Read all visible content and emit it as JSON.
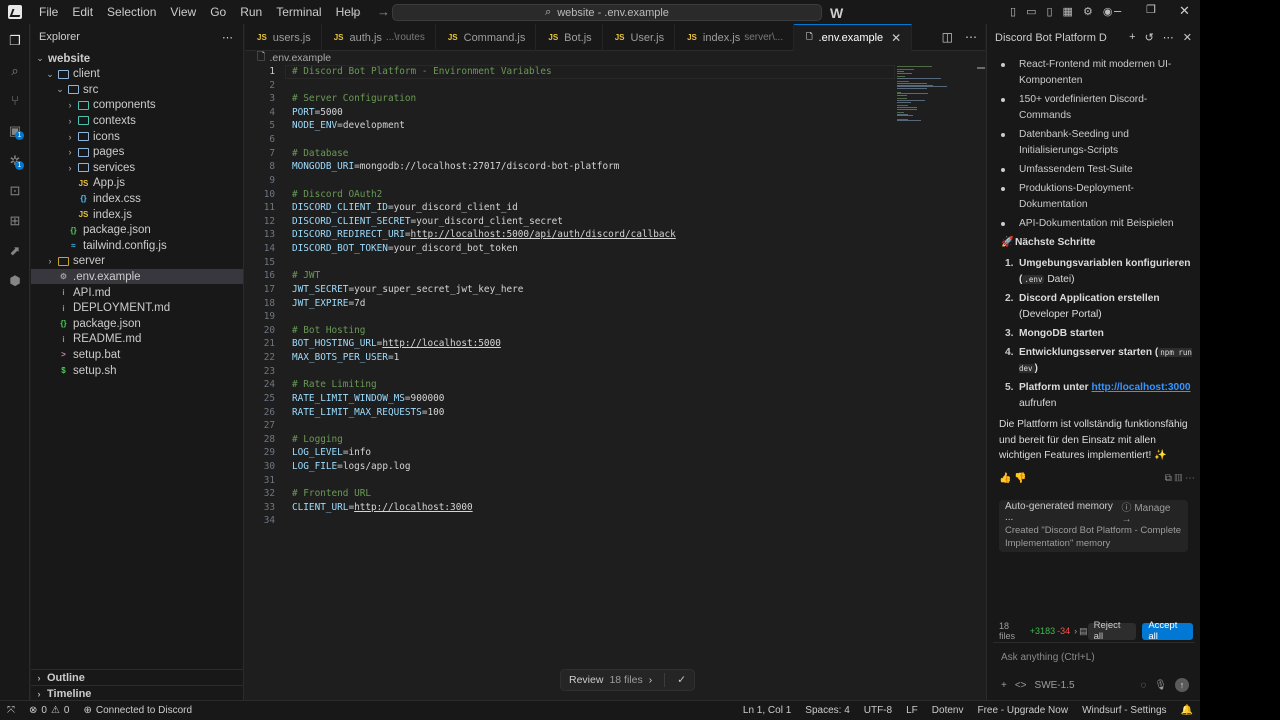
{
  "menu": [
    "File",
    "Edit",
    "Selection",
    "View",
    "Go",
    "Run",
    "Terminal",
    "Help"
  ],
  "search": {
    "text": "website - .env.example"
  },
  "sidebar": {
    "title": "Explorer",
    "tree": [
      {
        "label": "website",
        "type": "root",
        "depth": 0,
        "expanded": true
      },
      {
        "label": "client",
        "type": "folder",
        "depth": 1,
        "expanded": true
      },
      {
        "label": "src",
        "type": "folder",
        "depth": 2,
        "expanded": true
      },
      {
        "label": "components",
        "type": "folder",
        "depth": 3,
        "expanded": false
      },
      {
        "label": "contexts",
        "type": "folder",
        "depth": 3,
        "expanded": false
      },
      {
        "label": "icons",
        "type": "folder",
        "depth": 3,
        "expanded": false
      },
      {
        "label": "pages",
        "type": "folder",
        "depth": 3,
        "expanded": false
      },
      {
        "label": "services",
        "type": "folder",
        "depth": 3,
        "expanded": false
      },
      {
        "label": "App.js",
        "type": "js",
        "depth": 3
      },
      {
        "label": "index.css",
        "type": "css",
        "depth": 3
      },
      {
        "label": "index.js",
        "type": "js",
        "depth": 3
      },
      {
        "label": "package.json",
        "type": "json",
        "depth": 2
      },
      {
        "label": "tailwind.config.js",
        "type": "tw",
        "depth": 2
      },
      {
        "label": "server",
        "type": "folder",
        "depth": 1,
        "expanded": false
      },
      {
        "label": ".env.example",
        "type": "env",
        "depth": 1,
        "selected": true
      },
      {
        "label": "API.md",
        "type": "md",
        "depth": 1
      },
      {
        "label": "DEPLOYMENT.md",
        "type": "md",
        "depth": 1
      },
      {
        "label": "package.json",
        "type": "json",
        "depth": 1
      },
      {
        "label": "README.md",
        "type": "md",
        "depth": 1
      },
      {
        "label": "setup.bat",
        "type": "bat",
        "depth": 1
      },
      {
        "label": "setup.sh",
        "type": "sh",
        "depth": 1
      }
    ],
    "outline": "Outline",
    "timeline": "Timeline"
  },
  "tabs": [
    {
      "label": "users.js",
      "sub": "",
      "icon": "JS"
    },
    {
      "label": "auth.js",
      "sub": "...\\routes",
      "icon": "JS"
    },
    {
      "label": "Command.js",
      "sub": "",
      "icon": "JS"
    },
    {
      "label": "Bot.js",
      "sub": "",
      "icon": "JS"
    },
    {
      "label": "User.js",
      "sub": "",
      "icon": "JS"
    },
    {
      "label": "index.js",
      "sub": "server\\...",
      "icon": "JS"
    },
    {
      "label": ".env.example",
      "sub": "",
      "icon": "env",
      "active": true
    }
  ],
  "breadcrumb": ".env.example",
  "editor": {
    "current_line": 1,
    "lines": [
      "# Discord Bot Platform - Environment Variables",
      "",
      "# Server Configuration",
      "PORT=5000",
      "NODE_ENV=development",
      "",
      "# Database",
      "MONGODB_URI=mongodb://localhost:27017/discord-bot-platform",
      "",
      "# Discord OAuth2",
      "DISCORD_CLIENT_ID=your_discord_client_id",
      "DISCORD_CLIENT_SECRET=your_discord_client_secret",
      "DISCORD_REDIRECT_URI=http://localhost:5000/api/auth/discord/callback",
      "DISCORD_BOT_TOKEN=your_discord_bot_token",
      "",
      "# JWT",
      "JWT_SECRET=your_super_secret_jwt_key_here",
      "JWT_EXPIRE=7d",
      "",
      "# Bot Hosting",
      "BOT_HOSTING_URL=http://localhost:5000",
      "MAX_BOTS_PER_USER=1",
      "",
      "# Rate Limiting",
      "RATE_LIMIT_WINDOW_MS=900000",
      "RATE_LIMIT_MAX_REQUESTS=100",
      "",
      "# Logging",
      "LOG_LEVEL=info",
      "LOG_FILE=logs/app.log",
      "",
      "# Frontend URL",
      "CLIENT_URL=http://localhost:3000",
      ""
    ]
  },
  "review": {
    "label": "Review",
    "count": "18 files"
  },
  "chat": {
    "title": "Discord Bot Platform D",
    "bullets": [
      "React-Frontend mit modernen UI-Komponenten",
      "150+ vordefinierten Discord-Commands",
      "Datenbank-Seeding und Initialisierungs-Scripts",
      "Umfassendem Test-Suite",
      "Produktions-Deployment-Dokumentation",
      "API-Dokumentation mit Beispielen"
    ],
    "next_heading": "Nächste Schritte",
    "steps": [
      {
        "n": "1.",
        "bold": "Umgebungsvariablen konfigurieren",
        "code": ".env",
        "rest": "Datei)"
      },
      {
        "n": "2.",
        "bold": "Discord Application erstellen",
        "rest": "(Developer Portal)"
      },
      {
        "n": "3.",
        "bold": "MongoDB starten"
      },
      {
        "n": "4.",
        "bold": "Entwicklungsserver starten",
        "code": "npm run dev"
      },
      {
        "n": "5.",
        "bold": "Platform unter",
        "link": "http://localhost:3000",
        "rest": "aufrufen"
      }
    ],
    "summary": "Die Plattform ist vollständig funktionsfähig und bereit für den Einsatz mit allen wichtigen Features implementiert!",
    "memory": {
      "title": "Auto-generated memory ...",
      "manage": "Manage",
      "text": "Created \"Discord Bot Platform - Complete Implementation\" memory"
    },
    "files": {
      "count": "18 files",
      "added": "+3183",
      "removed": "-34"
    },
    "reject": "Reject all",
    "accept": "Accept all",
    "input_placeholder": "Ask anything (Ctrl+L)",
    "model": "SWE-1.5"
  },
  "status": {
    "errors": "0",
    "warnings": "0",
    "connection": "Connected to Discord",
    "position": "Ln 1, Col 1",
    "spaces": "Spaces: 4",
    "encoding": "UTF-8",
    "eol": "LF",
    "language": "Dotenv",
    "upgrade": "Free - Upgrade Now",
    "settings": "Windsurf - Settings"
  },
  "colors": {
    "accent": "#0078d4",
    "comment": "#6a9955",
    "key": "#9cdcfe",
    "added": "#3fb950",
    "removed": "#f85149"
  }
}
